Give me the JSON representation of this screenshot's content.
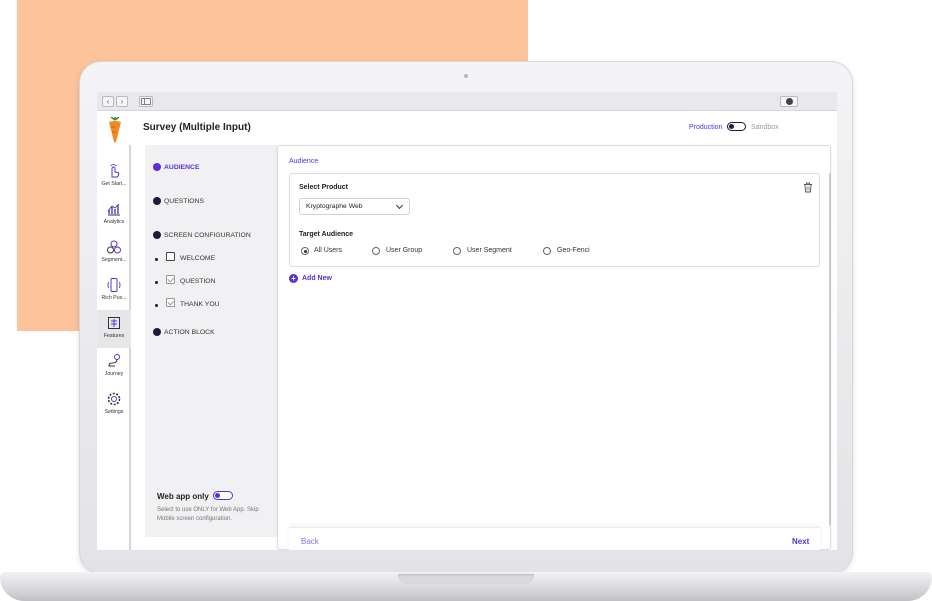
{
  "browser": {
    "back_glyph": "‹",
    "forward_glyph": "›"
  },
  "header": {
    "title": "Survey (Multiple Input)",
    "env_production": "Production",
    "env_sandbox": "Sandbox"
  },
  "nav": {
    "items": [
      {
        "label": "Get Start...",
        "icon": "hand-pointer-icon"
      },
      {
        "label": "Analytics",
        "icon": "chart-icon"
      },
      {
        "label": "Segment...",
        "icon": "segment-icon"
      },
      {
        "label": "Rich Pus...",
        "icon": "mobile-push-icon"
      },
      {
        "label": "Features",
        "icon": "features-icon"
      },
      {
        "label": "Journey",
        "icon": "journey-icon"
      },
      {
        "label": "Settings",
        "icon": "gear-icon"
      }
    ]
  },
  "steps": {
    "audience": "AUDIENCE",
    "questions": "QUESTIONS",
    "screen_configuration": "SCREEN CONFIGURATION",
    "welcome": "WELCOME",
    "question": "QUESTION",
    "thank_you": "THANK YOU",
    "action_block": "ACTION BLOCK",
    "web_app_title": "Web app only",
    "web_app_desc": "Select to use ONLY for Web App. Skip Mobile screen configuration."
  },
  "main": {
    "section_label": "Audience",
    "select_product_label": "Select Product",
    "select_product_value": "Kryptographe Web",
    "target_audience_label": "Target Audience",
    "audience_options": [
      "All Users",
      "User Group",
      "User Segment",
      "Geo-Fenci"
    ],
    "add_new": "Add New",
    "back": "Back",
    "next": "Next"
  },
  "colors": {
    "accent": "#5b2fd6",
    "dark": "#1e1a3a",
    "peach": "#fdc39b"
  }
}
